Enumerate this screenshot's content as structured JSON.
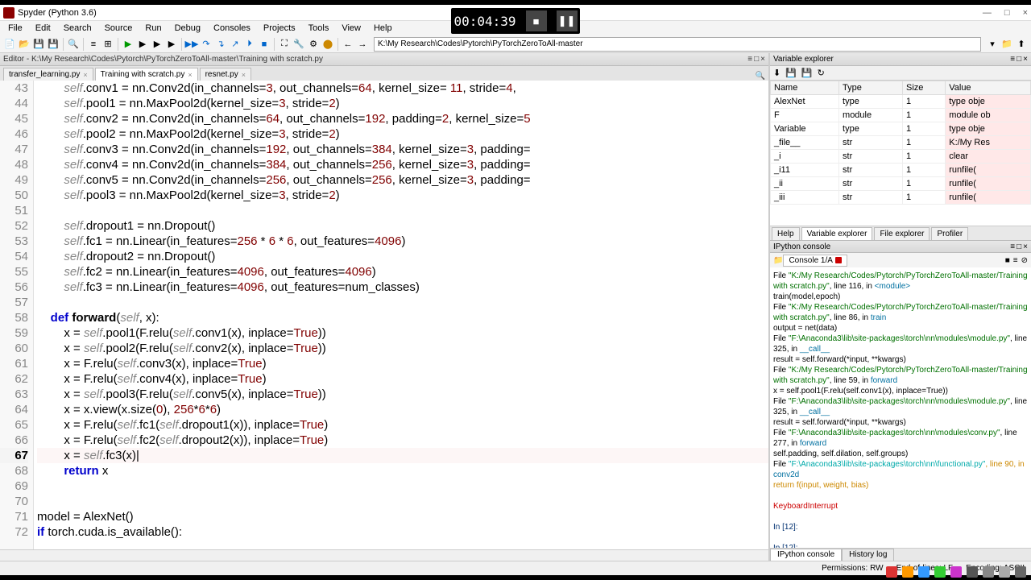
{
  "window": {
    "title": "Spyder (Python 3.6)",
    "minimize": "—",
    "maximize": "□",
    "close": "×"
  },
  "menu": {
    "items": [
      "File",
      "Edit",
      "Search",
      "Source",
      "Run",
      "Debug",
      "Consoles",
      "Projects",
      "Tools",
      "View",
      "Help"
    ]
  },
  "toolbar": {
    "path": "K:\\My Research\\Codes\\Pytorch\\PyTorchZeroToAll-master"
  },
  "editor": {
    "header": "Editor - K:\\My Research\\Codes\\Pytorch\\PyTorchZeroToAll-master\\Training with scratch.py",
    "tabs": [
      {
        "label": "transfer_learning.py",
        "active": false
      },
      {
        "label": "Training with scratch.py",
        "active": true
      },
      {
        "label": "resnet.py",
        "active": false
      }
    ],
    "first_line": 43,
    "current_line": 67,
    "lines": [
      {
        "n": 43,
        "html": "        <span class='k-self'>self</span>.conv1 = nn.Conv2d(in_channels=<span class='k-num'>3</span>, out_channels=<span class='k-num'>64</span>, kernel_size= <span class='k-num'>11</span>, stride=<span class='k-num'>4</span>,"
      },
      {
        "n": 44,
        "html": "        <span class='k-self'>self</span>.pool1 = nn.MaxPool2d(kernel_size=<span class='k-num'>3</span>, stride=<span class='k-num'>2</span>)"
      },
      {
        "n": 45,
        "html": "        <span class='k-self'>self</span>.conv2 = nn.Conv2d(in_channels=<span class='k-num'>64</span>, out_channels=<span class='k-num'>192</span>, padding=<span class='k-num'>2</span>, kernel_size=<span class='k-num'>5</span>"
      },
      {
        "n": 46,
        "html": "        <span class='k-self'>self</span>.pool2 = nn.MaxPool2d(kernel_size=<span class='k-num'>3</span>, stride=<span class='k-num'>2</span>)"
      },
      {
        "n": 47,
        "html": "        <span class='k-self'>self</span>.conv3 = nn.Conv2d(in_channels=<span class='k-num'>192</span>, out_channels=<span class='k-num'>384</span>, kernel_size=<span class='k-num'>3</span>, padding="
      },
      {
        "n": 48,
        "html": "        <span class='k-self'>self</span>.conv4 = nn.Conv2d(in_channels=<span class='k-num'>384</span>, out_channels=<span class='k-num'>256</span>, kernel_size=<span class='k-num'>3</span>, padding="
      },
      {
        "n": 49,
        "html": "        <span class='k-self'>self</span>.conv5 = nn.Conv2d(in_channels=<span class='k-num'>256</span>, out_channels=<span class='k-num'>256</span>, kernel_size=<span class='k-num'>3</span>, padding="
      },
      {
        "n": 50,
        "html": "        <span class='k-self'>self</span>.pool3 = nn.MaxPool2d(kernel_size=<span class='k-num'>3</span>, stride=<span class='k-num'>2</span>)"
      },
      {
        "n": 51,
        "html": ""
      },
      {
        "n": 52,
        "html": "        <span class='k-self'>self</span>.dropout1 = nn.Dropout()"
      },
      {
        "n": 53,
        "html": "        <span class='k-self'>self</span>.fc1 = nn.Linear(in_features=<span class='k-num'>256</span> * <span class='k-num'>6</span> * <span class='k-num'>6</span>, out_features=<span class='k-num'>4096</span>)"
      },
      {
        "n": 54,
        "html": "        <span class='k-self'>self</span>.dropout2 = nn.Dropout()"
      },
      {
        "n": 55,
        "html": "        <span class='k-self'>self</span>.fc2 = nn.Linear(in_features=<span class='k-num'>4096</span>, out_features=<span class='k-num'>4096</span>)"
      },
      {
        "n": 56,
        "html": "        <span class='k-self'>self</span>.fc3 = nn.Linear(in_features=<span class='k-num'>4096</span>, out_features=num_classes)"
      },
      {
        "n": 57,
        "html": ""
      },
      {
        "n": 58,
        "html": "    <span class='k-def'>def</span> <span class='k-kw'>forward</span>(<span class='k-self'>self</span>, x):"
      },
      {
        "n": 59,
        "html": "        x = <span class='k-self'>self</span>.pool1(F.relu(<span class='k-self'>self</span>.conv1(x), inplace=<span class='k-bool'>True</span>))"
      },
      {
        "n": 60,
        "html": "        x = <span class='k-self'>self</span>.pool2(F.relu(<span class='k-self'>self</span>.conv2(x), inplace=<span class='k-bool'>True</span>))"
      },
      {
        "n": 61,
        "html": "        x = F.relu(<span class='k-self'>self</span>.conv3(x), inplace=<span class='k-bool'>True</span>)"
      },
      {
        "n": 62,
        "html": "        x = F.relu(<span class='k-self'>self</span>.conv4(x), inplace=<span class='k-bool'>True</span>)"
      },
      {
        "n": 63,
        "html": "        x = <span class='k-self'>self</span>.pool3(F.relu(<span class='k-self'>self</span>.conv5(x), inplace=<span class='k-bool'>True</span>))"
      },
      {
        "n": 64,
        "html": "        x = x.view(x.size(<span class='k-num'>0</span>), <span class='k-num'>256</span>*<span class='k-num'>6</span>*<span class='k-num'>6</span>)"
      },
      {
        "n": 65,
        "html": "        x = F.relu(<span class='k-self'>self</span>.fc1(<span class='k-self'>self</span>.dropout1(x)), inplace=<span class='k-bool'>True</span>)"
      },
      {
        "n": 66,
        "html": "        x = F.relu(<span class='k-self'>self</span>.fc2(<span class='k-self'>self</span>.dropout2(x)), inplace=<span class='k-bool'>True</span>)"
      },
      {
        "n": 67,
        "html": "        x = <span class='k-self'>self</span>.fc3(x)|"
      },
      {
        "n": 68,
        "html": "        <span class='k-def'>return</span> x"
      },
      {
        "n": 69,
        "html": ""
      },
      {
        "n": 70,
        "html": ""
      },
      {
        "n": 71,
        "html": "model = AlexNet()"
      },
      {
        "n": 72,
        "html": "<span class='k-if'>if</span> torch.cuda.is_available():"
      }
    ]
  },
  "variable_explorer": {
    "title": "Variable explorer",
    "columns": [
      "Name",
      "Type",
      "Size",
      "Value"
    ],
    "rows": [
      {
        "name": "AlexNet",
        "type": "type",
        "size": "1",
        "value": "type obje"
      },
      {
        "name": "F",
        "type": "module",
        "size": "1",
        "value": "module ob"
      },
      {
        "name": "Variable",
        "type": "type",
        "size": "1",
        "value": "type obje"
      },
      {
        "name": "_file__",
        "type": "str",
        "size": "1",
        "value": "K:/My Res"
      },
      {
        "name": "_i",
        "type": "str",
        "size": "1",
        "value": "clear"
      },
      {
        "name": "_i11",
        "type": "str",
        "size": "1",
        "value": "runfile("
      },
      {
        "name": "_ii",
        "type": "str",
        "size": "1",
        "value": "runfile("
      },
      {
        "name": "_iii",
        "type": "str",
        "size": "1",
        "value": "runfile("
      }
    ],
    "tabs": [
      "Help",
      "Variable explorer",
      "File explorer",
      "Profiler"
    ],
    "active_tab": 1
  },
  "ipython": {
    "title": "IPython console",
    "console_tab": "Console 1/A",
    "lines": [
      {
        "html": "  File <span class='file'>\"K:/My Research/Codes/Pytorch/PyTorchZeroToAll-master/Training with scratch.py\"</span>, line <span class='ln'>116</span>, in <span class='loc'>&lt;module&gt;</span>"
      },
      {
        "html": "    train(model,epoch)"
      },
      {
        "html": "  File <span class='file'>\"K:/My Research/Codes/Pytorch/PyTorchZeroToAll-master/Training with scratch.py\"</span>, line <span class='ln'>86</span>, in <span class='loc'>train</span>"
      },
      {
        "html": "    output = net(data)"
      },
      {
        "html": "  File <span class='file'>\"F:\\Anaconda3\\lib\\site-packages\\torch\\nn\\modules\\module.py\"</span>, line <span class='ln'>325</span>, in <span class='loc'>__call__</span>"
      },
      {
        "html": "    result = self.forward(*input, **kwargs)"
      },
      {
        "html": "  File <span class='file'>\"K:/My Research/Codes/Pytorch/PyTorchZeroToAll-master/Training with scratch.py\"</span>, line <span class='ln'>59</span>, in <span class='loc'>forward</span>"
      },
      {
        "html": "    x = self.pool1(F.relu(self.conv1(x), inplace=True))"
      },
      {
        "html": "  File <span class='file'>\"F:\\Anaconda3\\lib\\site-packages\\torch\\nn\\modules\\module.py\"</span>, line <span class='ln'>325</span>, in <span class='loc'>__call__</span>"
      },
      {
        "html": "    result = self.forward(*input, **kwargs)"
      },
      {
        "html": "  File <span class='file'>\"F:\\Anaconda3\\lib\\site-packages\\torch\\nn\\modules\\conv.py\"</span>, line <span class='ln'>277</span>, in <span class='loc'>forward</span>"
      },
      {
        "html": "    self.padding, self.dilation, self.groups)"
      },
      {
        "html": "  File <span class='cyan'>\"F:\\Anaconda3\\lib\\site-packages\\torch\\nn\\functional.py\"</span><span class='orange'>, line 90, in </span><span class='loc'>conv2d</span>"
      },
      {
        "html": "    <span class='orange'>return f(input, weight, bias)</span>"
      },
      {
        "html": ""
      },
      {
        "html": "<span class='red'>KeyboardInterrupt</span>"
      },
      {
        "html": ""
      },
      {
        "html": "<span class='prompt'>In [12]:</span>"
      },
      {
        "html": ""
      },
      {
        "html": "<span class='prompt'>In [12]:</span>"
      }
    ],
    "bottom_tabs": [
      "IPython console",
      "History log"
    ]
  },
  "statusbar": {
    "permissions": "Permissions: RW",
    "eol": "End-of-lines: LF",
    "encoding": "Encoding: ASCII"
  },
  "video": {
    "time": "00:04:39",
    "stop": "■",
    "pause": "❚❚"
  }
}
